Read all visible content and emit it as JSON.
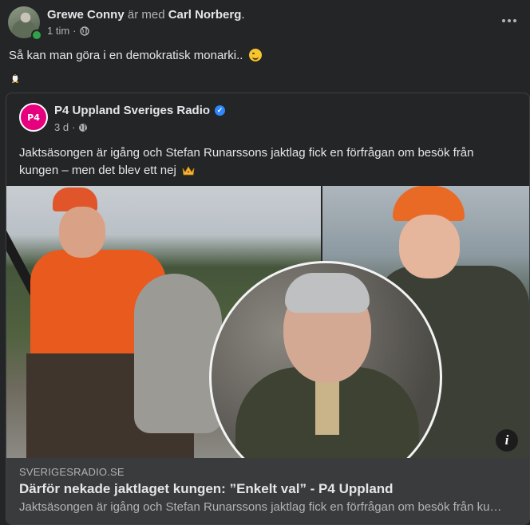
{
  "post": {
    "author": "Grewe Conny",
    "with_text": "är med",
    "tagged": "Carl Norberg",
    "tagged_suffix": ".",
    "time": "1 tim",
    "separator": "·",
    "text": "Så kan man göra i en demokratisk monarki.. "
  },
  "shared": {
    "page_name": "P4 Uppland Sveriges Radio",
    "logo_text": "P4",
    "time": "3 d",
    "separator": "·",
    "text": "Jaktsäsongen är igång och Stefan Runarssons jaktlag fick en förfrågan om besök från kungen – men det blev ett nej "
  },
  "link": {
    "domain": "SVERIGESRADIO.SE",
    "title": "Därför nekade jaktlaget kungen: ”Enkelt val” - P4 Uppland",
    "description": "Jaktsäsongen är igång och Stefan Runarssons jaktlag fick en förfrågan om besök från kungen – men det blev ett nej",
    "info_glyph": "i"
  },
  "colors": {
    "background": "#242526",
    "link_bar": "#3a3b3c",
    "verified": "#2d88ff",
    "p4_brand": "#e6007e",
    "online": "#31a24c"
  }
}
